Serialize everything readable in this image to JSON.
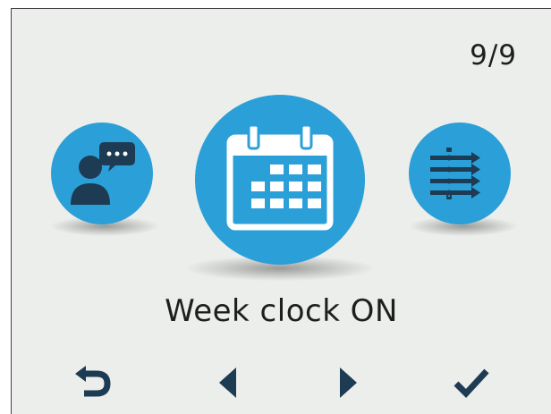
{
  "page_counter": "9/9",
  "current_item": {
    "label": "Week clock ON",
    "icon": "calendar-icon"
  },
  "carousel": {
    "previous_icon": "user-message-icon",
    "next_icon": "schedule-list-icon"
  },
  "navigation": {
    "back_icon": "back-arrow-icon",
    "prev_icon": "triangle-left-icon",
    "next_icon": "triangle-right-icon",
    "confirm_icon": "checkmark-icon"
  },
  "colors": {
    "accent": "#2b9fd8",
    "icon_dark": "#1d3b52",
    "background": "#eceeeb",
    "text": "#1e1e1e"
  }
}
